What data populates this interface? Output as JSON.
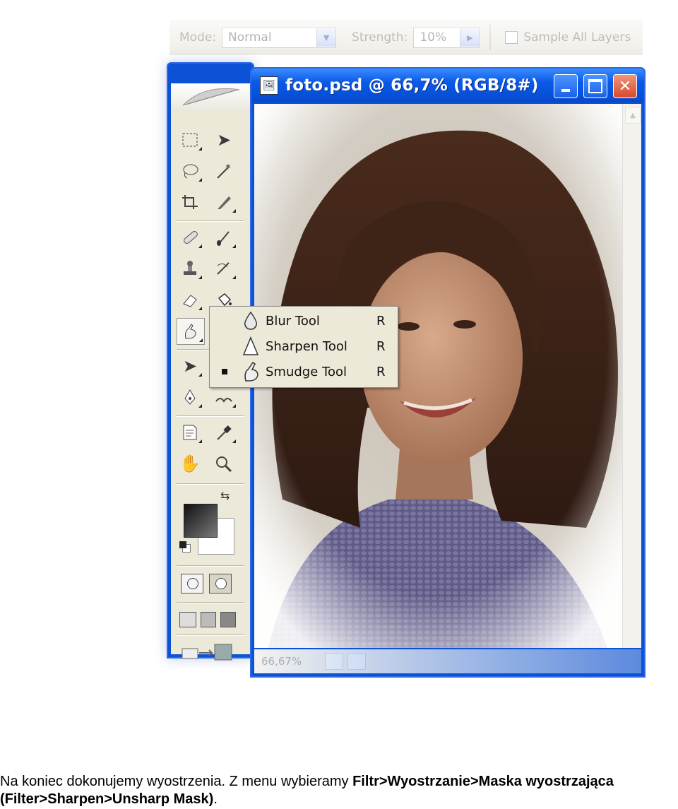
{
  "options_bar": {
    "mode_label": "Mode:",
    "mode_value": "Normal",
    "strength_label": "Strength:",
    "strength_value": "10%",
    "sample_all_layers_label": "Sample All Layers"
  },
  "document_window": {
    "title": "foto.psd @ 66,7% (RGB/8#)",
    "zoom_status": "66,67%"
  },
  "toolbox": {
    "tools": [
      "rectangular-marquee-icon",
      "move-icon",
      "lasso-icon",
      "magic-wand-icon",
      "crop-icon",
      "slice-icon",
      "healing-brush-icon",
      "brush-icon",
      "clone-stamp-icon",
      "history-brush-icon",
      "eraser-icon",
      "paint-bucket-icon",
      "smudge-icon",
      "dodge-icon",
      "path-selection-icon",
      "type-icon",
      "pen-icon",
      "custom-shape-icon",
      "notes-icon",
      "eyedropper-icon",
      "hand-icon",
      "zoom-icon"
    ],
    "foreground_color": "#2a2a2a",
    "background_color": "#ffffff"
  },
  "flyout_menu": {
    "items": [
      {
        "label": "Blur Tool",
        "shortcut": "R",
        "selected": false,
        "icon": "blur-drop-icon"
      },
      {
        "label": "Sharpen Tool",
        "shortcut": "R",
        "selected": false,
        "icon": "sharpen-cone-icon"
      },
      {
        "label": "Smudge Tool",
        "shortcut": "R",
        "selected": true,
        "icon": "smudge-finger-icon"
      }
    ]
  },
  "caption": {
    "normal1": "Na koniec dokonujemy wyostrzenia. Z menu wybieramy ",
    "bold1": "Filtr>Wyostrzanie>Maska wyostrzająca",
    "bold2": "(Filter>Sharpen>Unsharp Mask)",
    "normal2": "."
  },
  "colors": {
    "xp_blue": "#0b52d6",
    "panel_bg": "#ece9d8",
    "close_red": "#d8482a"
  }
}
